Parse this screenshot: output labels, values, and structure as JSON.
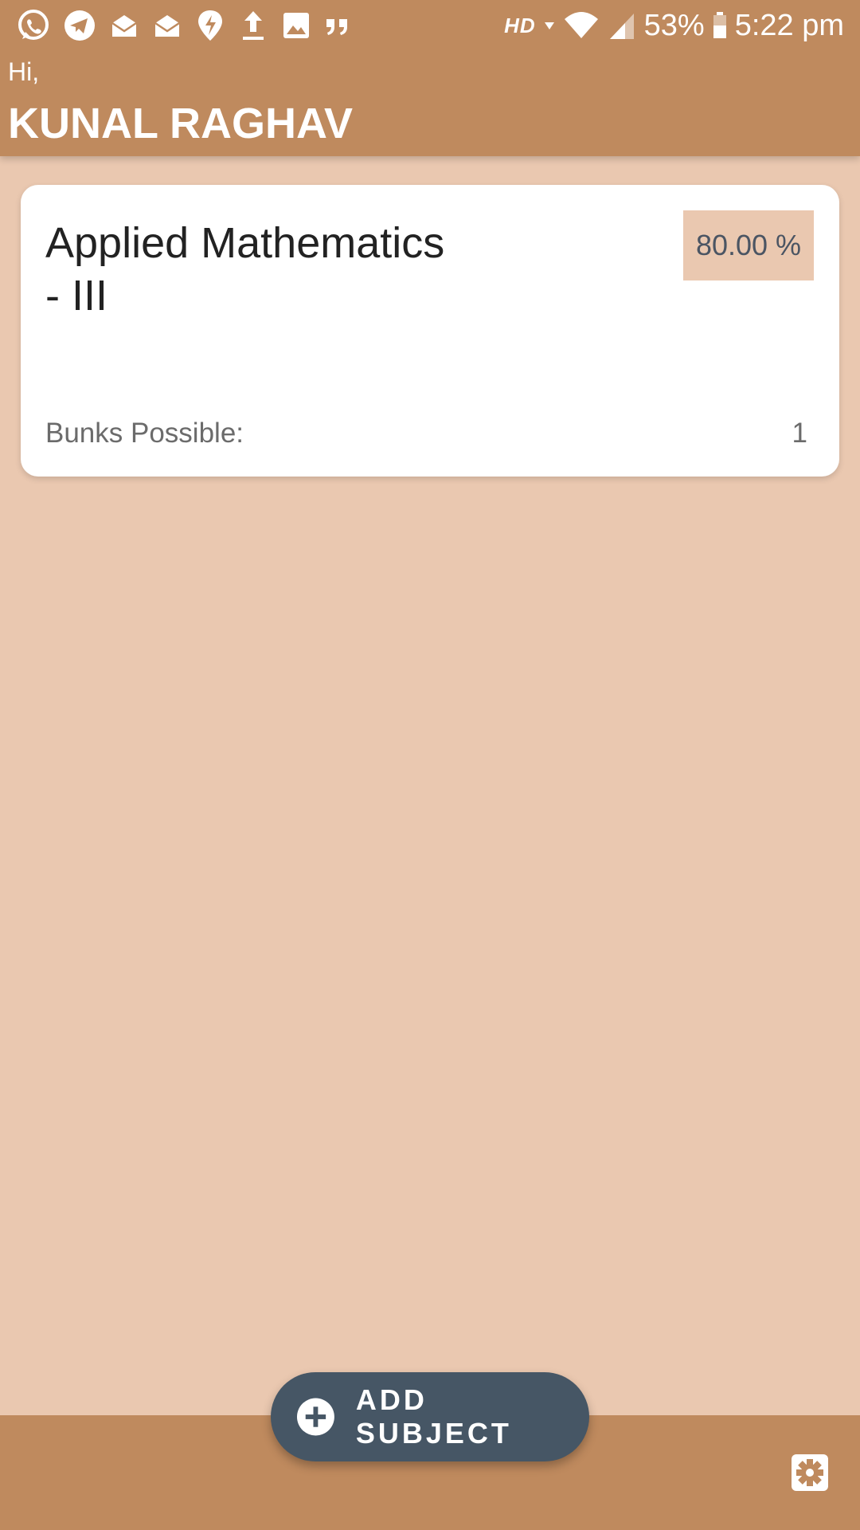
{
  "status_bar": {
    "network_label": "HD",
    "battery": "53%",
    "time": "5:22 pm",
    "icons": [
      "whatsapp-icon",
      "telegram-icon",
      "mail-icon",
      "mail-icon",
      "location-icon",
      "upload-icon",
      "image-icon",
      "quote-icon",
      "signal-icon",
      "wifi-icon",
      "battery-icon"
    ]
  },
  "header": {
    "greeting": "Hi,",
    "user_name": "KUNAL RAGHAV"
  },
  "subjects": [
    {
      "name": "Applied Mathematics - III",
      "attendance": "80.00 %",
      "bunks_label": "Bunks Possible:",
      "bunks_value": "1"
    }
  ],
  "fab": {
    "label": "ADD SUBJECT",
    "icon": "plus-circle-icon"
  },
  "bottom_bar": {
    "settings_icon": "gear-icon"
  },
  "colors": {
    "primary": "#BF8A5E",
    "background": "#EAC8B0",
    "fab": "#465665",
    "card": "#FFFFFF"
  }
}
